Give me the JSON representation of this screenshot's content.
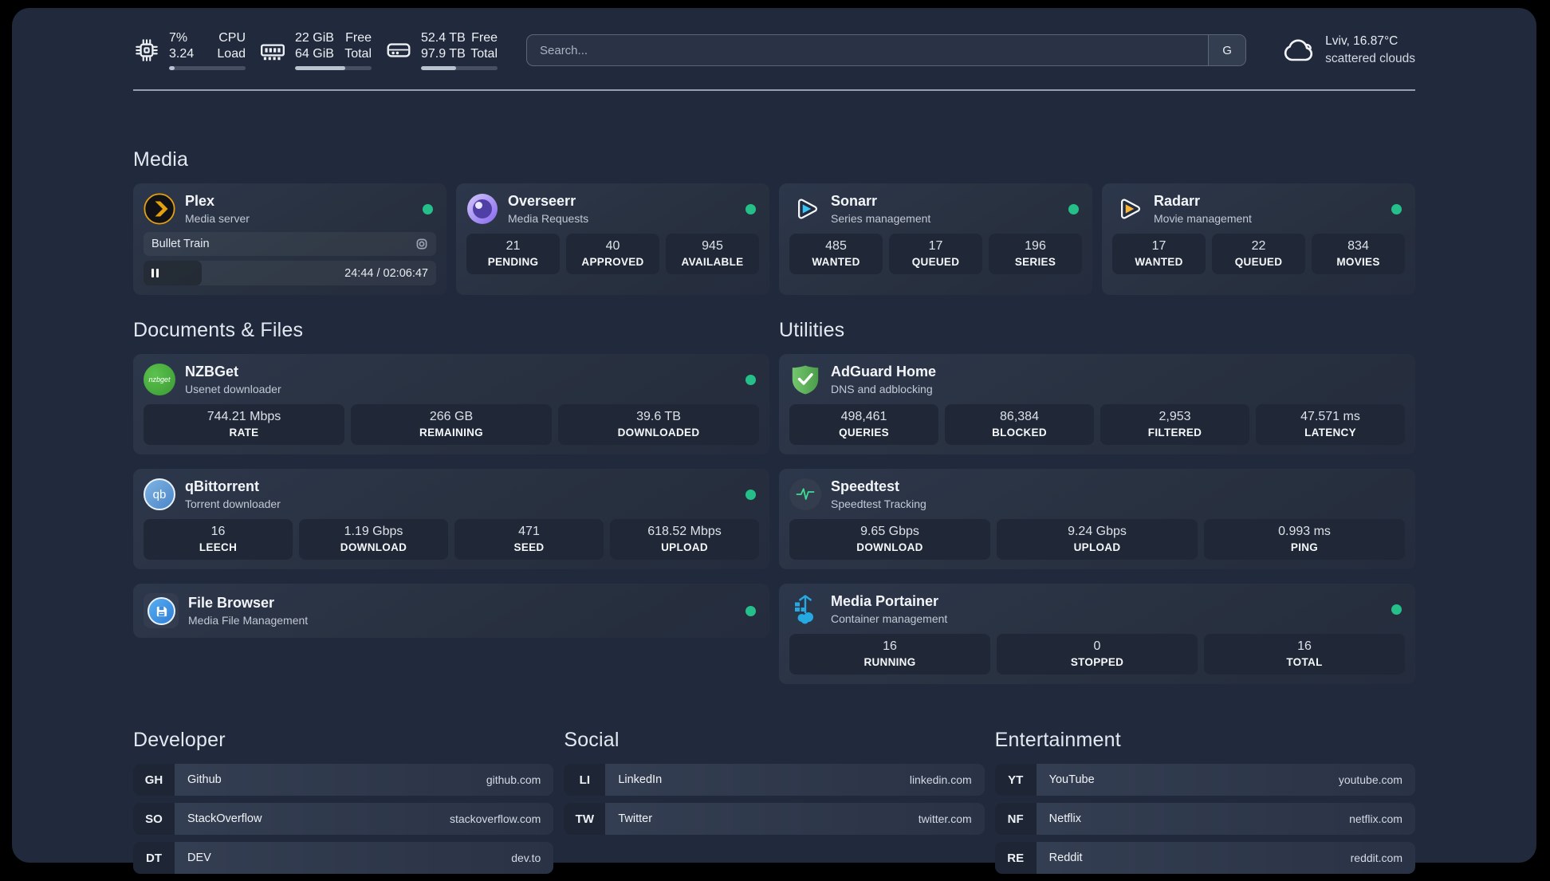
{
  "colors": {
    "outer_background": "#000000",
    "surface": "#212a3c",
    "card": "#2a3447",
    "tile": "#202837",
    "status_online": "#25c08a",
    "plex_accent": "#e5a00d",
    "sonarr_accent": "#3ac3f2",
    "radarr_accent": "#f7b53a",
    "nzbget_accent": "#47a83c",
    "qbittorrent_accent": "#4a86c8",
    "filebrowser_accent": "#2f7fd6",
    "adguard_accent": "#5fae58",
    "speedtest_accent": "#3fdc96",
    "portainer_accent": "#25a9e0"
  },
  "topbar": {
    "stats": [
      {
        "icon": "cpu-icon",
        "values": [
          "7%",
          "3.24"
        ],
        "labels": [
          "CPU",
          "Load"
        ],
        "progress_pct": 7
      },
      {
        "icon": "memory-icon",
        "values": [
          "22 GiB",
          "64 GiB"
        ],
        "labels": [
          "Free",
          "Total"
        ],
        "progress_pct": 66
      },
      {
        "icon": "storage-icon",
        "values": [
          "52.4 TB",
          "97.9 TB"
        ],
        "labels": [
          "Free",
          "Total"
        ],
        "progress_pct": 46
      }
    ],
    "search": {
      "placeholder": "Search...",
      "engine_button": "G"
    },
    "weather": {
      "summary": "Lviv, 16.87°C",
      "condition": "scattered clouds"
    }
  },
  "sections": {
    "media": {
      "title": "Media",
      "cards": [
        {
          "title": "Plex",
          "subtitle": "Media server",
          "online": true,
          "player": {
            "track": "Bullet Train",
            "time": "24:44 / 02:06:47",
            "progress_pct": 20
          }
        },
        {
          "title": "Overseerr",
          "subtitle": "Media Requests",
          "online": true,
          "stats": [
            {
              "value": "21",
              "label": "PENDING"
            },
            {
              "value": "40",
              "label": "APPROVED"
            },
            {
              "value": "945",
              "label": "AVAILABLE"
            }
          ]
        },
        {
          "title": "Sonarr",
          "subtitle": "Series management",
          "online": true,
          "stats": [
            {
              "value": "485",
              "label": "WANTED"
            },
            {
              "value": "17",
              "label": "QUEUED"
            },
            {
              "value": "196",
              "label": "SERIES"
            }
          ]
        },
        {
          "title": "Radarr",
          "subtitle": "Movie management",
          "online": true,
          "stats": [
            {
              "value": "17",
              "label": "WANTED"
            },
            {
              "value": "22",
              "label": "QUEUED"
            },
            {
              "value": "834",
              "label": "MOVIES"
            }
          ]
        }
      ]
    },
    "documents": {
      "title": "Documents & Files",
      "cards": [
        {
          "title": "NZBGet",
          "subtitle": "Usenet downloader",
          "online": true,
          "stats": [
            {
              "value": "744.21 Mbps",
              "label": "RATE"
            },
            {
              "value": "266 GB",
              "label": "REMAINING"
            },
            {
              "value": "39.6 TB",
              "label": "DOWNLOADED"
            }
          ]
        },
        {
          "title": "qBittorrent",
          "subtitle": "Torrent downloader",
          "online": true,
          "stats": [
            {
              "value": "16",
              "label": "LEECH"
            },
            {
              "value": "1.19 Gbps",
              "label": "DOWNLOAD"
            },
            {
              "value": "471",
              "label": "SEED"
            },
            {
              "value": "618.52 Mbps",
              "label": "UPLOAD"
            }
          ]
        },
        {
          "title": "File Browser",
          "subtitle": "Media File Management",
          "online": true
        }
      ]
    },
    "utilities": {
      "title": "Utilities",
      "cards": [
        {
          "title": "AdGuard Home",
          "subtitle": "DNS and adblocking",
          "stats": [
            {
              "value": "498,461",
              "label": "QUERIES"
            },
            {
              "value": "86,384",
              "label": "BLOCKED"
            },
            {
              "value": "2,953",
              "label": "FILTERED"
            },
            {
              "value": "47.571 ms",
              "label": "LATENCY"
            }
          ]
        },
        {
          "title": "Speedtest",
          "subtitle": "Speedtest Tracking",
          "stats": [
            {
              "value": "9.65 Gbps",
              "label": "DOWNLOAD"
            },
            {
              "value": "9.24 Gbps",
              "label": "UPLOAD"
            },
            {
              "value": "0.993 ms",
              "label": "PING"
            }
          ]
        },
        {
          "title": "Media Portainer",
          "subtitle": "Container management",
          "online": true,
          "stats": [
            {
              "value": "16",
              "label": "RUNNING"
            },
            {
              "value": "0",
              "label": "STOPPED"
            },
            {
              "value": "16",
              "label": "TOTAL"
            }
          ]
        }
      ]
    },
    "developer": {
      "title": "Developer",
      "links": [
        {
          "abbr": "GH",
          "name": "Github",
          "url": "github.com"
        },
        {
          "abbr": "SO",
          "name": "StackOverflow",
          "url": "stackoverflow.com"
        },
        {
          "abbr": "DT",
          "name": "DEV",
          "url": "dev.to"
        }
      ]
    },
    "social": {
      "title": "Social",
      "links": [
        {
          "abbr": "LI",
          "name": "LinkedIn",
          "url": "linkedin.com"
        },
        {
          "abbr": "TW",
          "name": "Twitter",
          "url": "twitter.com"
        }
      ]
    },
    "entertainment": {
      "title": "Entertainment",
      "links": [
        {
          "abbr": "YT",
          "name": "YouTube",
          "url": "youtube.com"
        },
        {
          "abbr": "NF",
          "name": "Netflix",
          "url": "netflix.com"
        },
        {
          "abbr": "RE",
          "name": "Reddit",
          "url": "reddit.com"
        }
      ]
    }
  }
}
